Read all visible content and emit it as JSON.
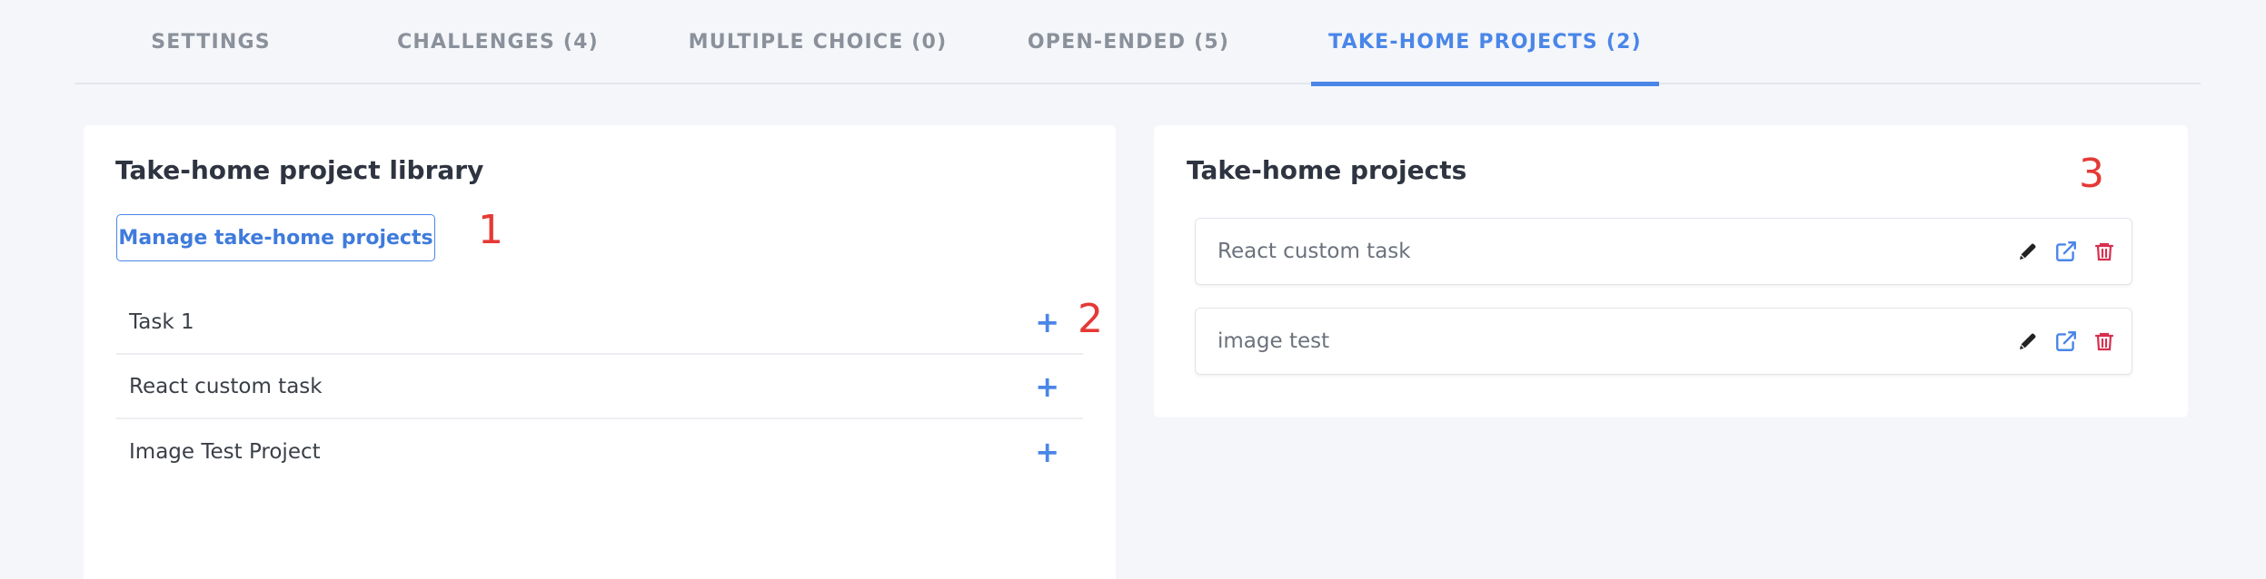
{
  "tabs": [
    {
      "label": "SETTINGS"
    },
    {
      "label": "CHALLENGES (4)"
    },
    {
      "label": "MULTIPLE CHOICE (0)"
    },
    {
      "label": "OPEN-ENDED (5)"
    },
    {
      "label": "TAKE-HOME PROJECTS (2)",
      "active": true
    }
  ],
  "library": {
    "title": "Take-home project library",
    "manage_button": "Manage take-home projects",
    "items": [
      {
        "label": "Task 1"
      },
      {
        "label": "React custom task"
      },
      {
        "label": "Image Test Project"
      }
    ]
  },
  "projects": {
    "title": "Take-home projects",
    "items": [
      {
        "label": "React custom task",
        "actions": [
          "pencil-icon",
          "external-link-icon",
          "trash-icon"
        ]
      },
      {
        "label": "image test",
        "actions": [
          "pencil-icon",
          "external-link-icon",
          "trash-icon"
        ]
      }
    ]
  },
  "markers": [
    "1",
    "2",
    "3"
  ],
  "colors": {
    "accent": "#4a86e8",
    "danger": "#d62f4f",
    "marker": "#e53935",
    "background": "#f5f6fa"
  }
}
